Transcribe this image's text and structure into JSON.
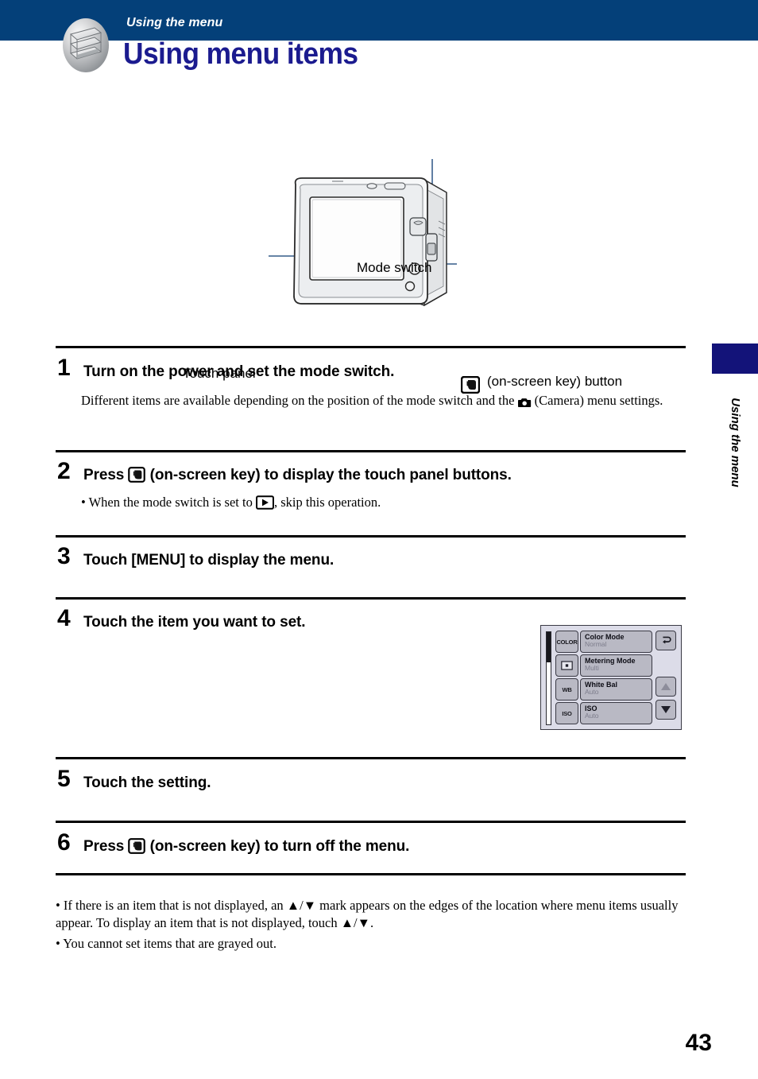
{
  "header": {
    "eyebrow": "Using the menu",
    "title": "Using menu items",
    "band_color": "#044079",
    "title_color": "#1b1b8f",
    "icon": "menu-pages-icon"
  },
  "figure": {
    "caption_mode_switch": "Mode switch",
    "caption_touch_panel": "Touch panel",
    "caption_on_screen_key": "(on-screen key) button",
    "device": "digital-still-camera-rear-view"
  },
  "steps": [
    {
      "number": "1",
      "heading": "Turn on the power and set the mode switch.",
      "body_before_icon": "Different items are available depending on the position of the mode switch and the ",
      "body_icon": "camera-icon",
      "body_after_icon": " (Camera) menu settings."
    },
    {
      "number": "2",
      "heading_before_icon": "Press ",
      "heading_icon": "on-screen-key-icon",
      "heading_after_icon": " (on-screen key) to display the touch panel buttons.",
      "bullet_before_icon": "• When the mode switch is set to ",
      "bullet_icon": "playback-icon",
      "bullet_after_icon": ", skip this operation."
    },
    {
      "number": "3",
      "heading": "Touch [MENU] to display the menu."
    },
    {
      "number": "4",
      "heading": "Touch the item you want to set."
    },
    {
      "number": "5",
      "heading": "Touch the setting."
    },
    {
      "number": "6",
      "heading_before_icon": "Press ",
      "heading_icon": "on-screen-key-icon",
      "heading_after_icon": " (on-screen key) to turn off the menu."
    }
  ],
  "menu_screenshot": {
    "rows": [
      {
        "badge": "COLOR",
        "badge_kind": "text",
        "title": "Color Mode",
        "value": "Normal"
      },
      {
        "badge": "",
        "badge_kind": "spot-metering-icon",
        "title": "Metering Mode",
        "value": "Multi"
      },
      {
        "badge": "WB",
        "badge_kind": "text",
        "title": "White Bal",
        "value": "Auto"
      },
      {
        "badge": "ISO",
        "badge_kind": "text",
        "title": "ISO",
        "value": "Auto"
      }
    ],
    "side_buttons": [
      {
        "name": "return-button",
        "glyph": "↩"
      },
      {
        "name": "scroll-up-button",
        "glyph": "▲"
      },
      {
        "name": "scroll-down-button",
        "glyph": "▼"
      }
    ]
  },
  "notes": [
    "• If there is an item that is not displayed, an ▲/▼ mark appears on the edges of the location where menu items usually appear. To display an item that is not displayed, touch ▲/▼.",
    "• You cannot set items that are grayed out."
  ],
  "side_tab": {
    "label": "Using the menu",
    "block_color": "#131379"
  },
  "page_number": "43"
}
